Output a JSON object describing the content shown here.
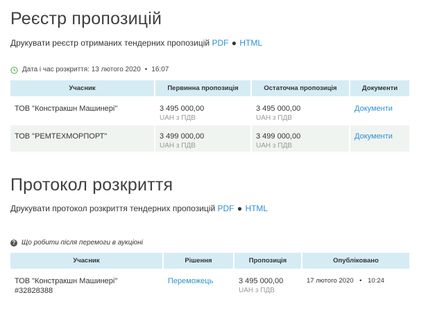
{
  "registry": {
    "title": "Реєстр пропозицій",
    "print_text": "Друкувати реєстр отриманих тендерних пропозицій",
    "pdf": "PDF",
    "sep": "●",
    "html": "HTML",
    "date_label": "Дата і час розкриття: 13 лютого 2020",
    "date_bullet": "•",
    "date_time": "16:07",
    "headers": [
      "Учасник",
      "Первинна пропозиція",
      "Остаточна пропозиція",
      "Документи"
    ],
    "rows": [
      {
        "participant": "ТОВ \"Констракшн Машинері\"",
        "initial_amount": "3 495 000,00",
        "initial_vat": "UAH з ПДВ",
        "final_amount": "3 495 000,00",
        "final_vat": "UAH з ПДВ",
        "documents": "Документи"
      },
      {
        "participant": "ТОВ \"РЕМТЕХМОРПОРТ\"",
        "initial_amount": "3 499 000,00",
        "initial_vat": "UAH з ПДВ",
        "final_amount": "3 499 000,00",
        "final_vat": "UAH з ПДВ",
        "documents": "Документи"
      }
    ]
  },
  "protocol": {
    "title": "Протокол розкриття",
    "print_text": "Друкувати протокол розкриття тендерних пропозицій",
    "pdf": "PDF",
    "sep": "●",
    "html": "HTML",
    "help_text": "Що робити після перемоги в аукціоні",
    "headers": [
      "Учасник",
      "Рішення",
      "Пропозиція",
      "Опубліковано"
    ],
    "rows": [
      {
        "participant": "ТОВ \"Констракшн Машинері\"",
        "participant_id": "#32828388",
        "decision": "Переможець",
        "amount": "3 495 000,00",
        "vat": "UAH з ПДВ",
        "published_date": "17 лютого 2020",
        "published_bullet": "•",
        "published_time": "10:24"
      }
    ]
  },
  "colors": {
    "link": "#2e8fd1",
    "header_bg": "#d5ecf5",
    "row_alt_bg": "#f0f4f0",
    "clock_icon": "#5cb85c"
  },
  "icons": {
    "clock": "clock-icon",
    "help": "question-circle-icon"
  }
}
